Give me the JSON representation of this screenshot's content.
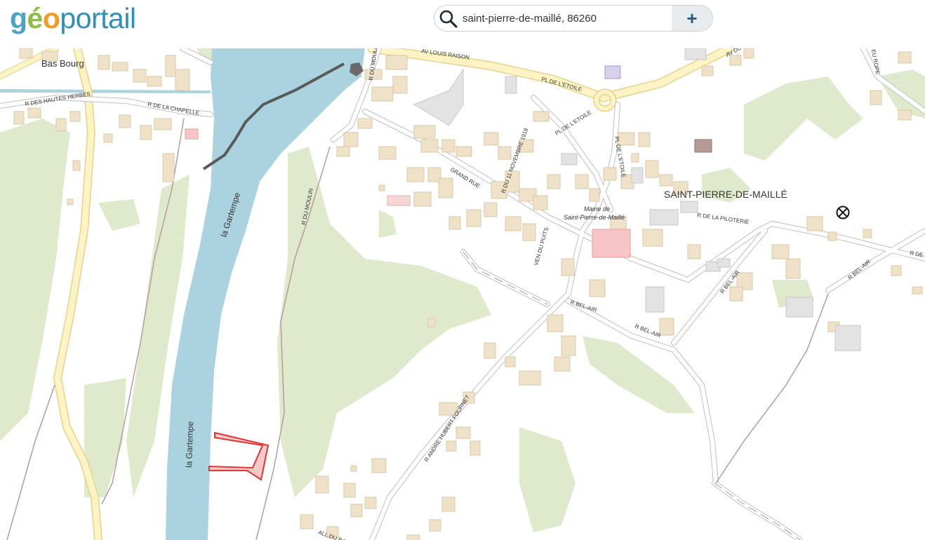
{
  "logo": {
    "g": "g",
    "e": "é",
    "o": "o",
    "rest": "portail"
  },
  "search": {
    "value": "saint-pierre-de-maillé, 86260",
    "add_label": "+"
  },
  "map": {
    "colors": {
      "water": "#aad3df",
      "vegetation": "#dfeacd",
      "building": "#efe2c9",
      "building_stroke": "#d9c8a4",
      "road": "#ffffff",
      "road_stroke": "#bfbfbf",
      "major_road": "#fdf3c4",
      "major_stroke": "#e2d488",
      "parcel": "#e33535"
    },
    "place_labels": {
      "town": "SAINT-PIERRE-DE-MAILLÉ",
      "hamlet": "Bas Bourg",
      "mairie_1": "Mairie de",
      "mairie_2": "Saint-Pierre-de-Maillé"
    },
    "water_labels": {
      "river_north": "la Gartempe",
      "river_south": "la Gartempe"
    },
    "street_labels": {
      "hautes_herbes": "R DES HAUTES HERBES",
      "chapelle": "R DE LA CHAPELLE",
      "du_moulin_north": "R DU MOULIN",
      "du_moulin_south": "R DU MOULIN",
      "louis_raison": "AV LOUIS RAISON",
      "etoile_1": "PL DE L'ETOILE",
      "etoile_2": "PL DE L'ETOILE",
      "etoile_3": "PL DE L'ETOILE",
      "novembre": "R DU 11 NOVEMBRE 1918",
      "grand_rue": "GRAND RUE",
      "venelle_puits": "VEN DU PUITS",
      "piloterie": "R DE LA PILOTERIE",
      "bel_air_1": "R BEL-AIR",
      "bel_air_2": "R BEL-AIR",
      "bel_air_3": "R BEL-AIR",
      "bel_air_4": "R BEL-AIR",
      "hubert_fournet": "R ANDRE HUBERT FOURNET",
      "barbousseau": "ALL DU BARBOUSSEAU",
      "av_du": "AV DU G",
      "edge_ne": "EU ROPE",
      "edge_e": "R DE L"
    },
    "marker": "cross-circle-icon"
  }
}
